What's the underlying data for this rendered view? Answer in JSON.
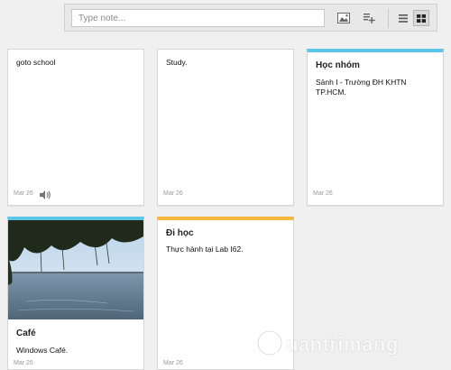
{
  "search": {
    "placeholder": "Type note..."
  },
  "toolbar": {
    "image_icon": "image-icon",
    "list_add_icon": "add-list-icon",
    "list_view_icon": "list-view-icon",
    "grid_view_icon": "grid-view-icon"
  },
  "notes": [
    {
      "title": "",
      "body": "goto school",
      "date": "Mar 26",
      "has_audio": true
    },
    {
      "title": "",
      "body": "Study.",
      "date": "Mar 26"
    },
    {
      "title": "Học nhóm",
      "body": "Sảnh I - Trường ĐH KHTN TP.HCM.",
      "date": "Mar 26",
      "accent": "#5bc7e8"
    },
    {
      "title": "Café",
      "body": "Windows Café.",
      "date": "Mar 26",
      "accent": "#5bc7e8",
      "has_image": true
    },
    {
      "title": "Đi học",
      "body": "Thực hành tại Lab I62.",
      "date": "Mar 26",
      "accent": "#f5b83d"
    }
  ],
  "watermark": {
    "text": "uantrimang"
  }
}
